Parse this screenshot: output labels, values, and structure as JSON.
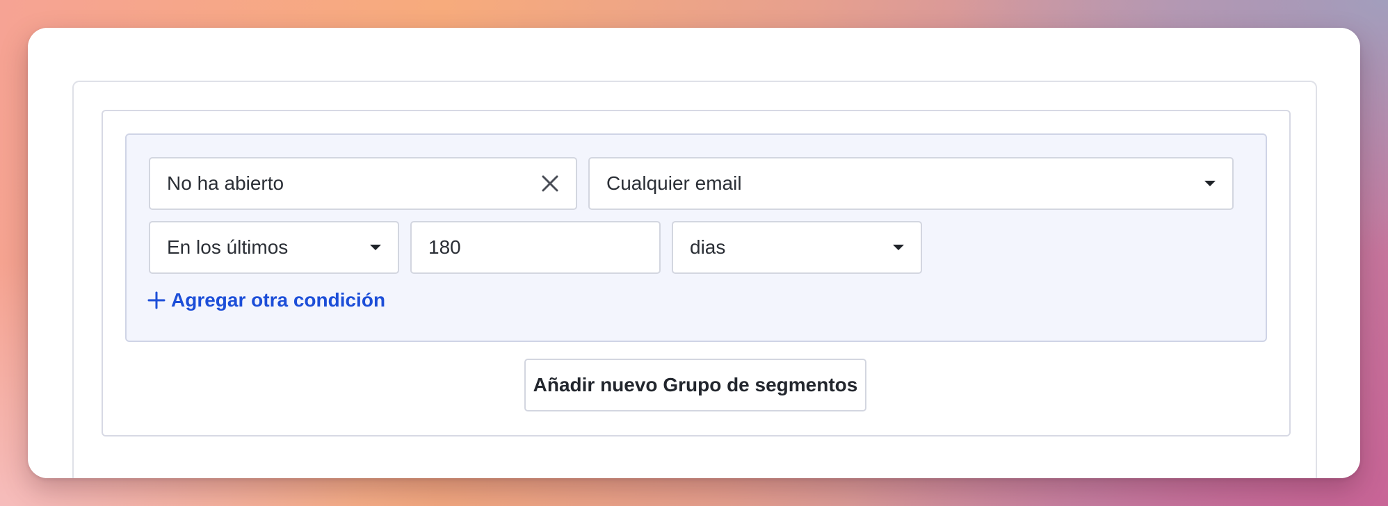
{
  "segment_builder": {
    "condition": {
      "type_value": "No ha abierto",
      "email_value": "Cualquier email",
      "period_value": "En los últimos",
      "amount_value": "180",
      "unit_value": "dias"
    },
    "add_condition_label": "Agregar otra condición",
    "add_group_label": "Añadir nuevo Grupo de segmentos"
  },
  "icons": {
    "clear": "close-icon",
    "dropdown": "chevron-down-icon",
    "add": "plus-icon"
  },
  "colors": {
    "link": "#1c4ed8",
    "group_background": "#f3f5fd",
    "border": "#d3d6e0"
  }
}
